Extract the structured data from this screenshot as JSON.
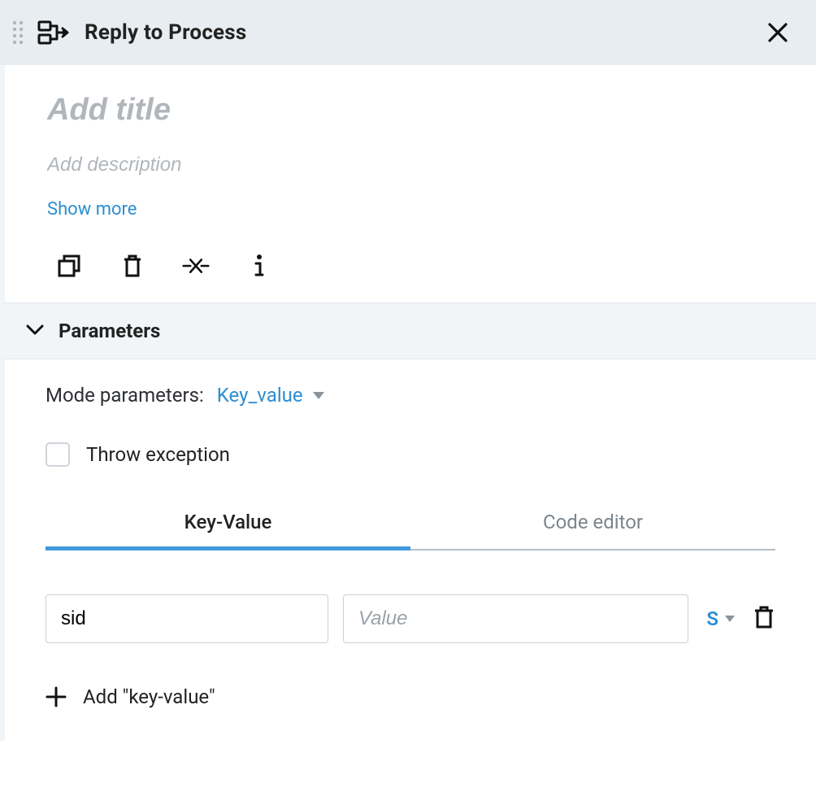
{
  "header": {
    "title": "Reply to Process"
  },
  "body": {
    "title_placeholder": "Add title",
    "title_value": "",
    "desc_placeholder": "Add description",
    "desc_value": "",
    "show_more": "Show more"
  },
  "section": {
    "parameters_label": "Parameters"
  },
  "params": {
    "mode_label": "Mode parameters:",
    "mode_value": "Key_value",
    "throw_label": "Throw exception",
    "throw_checked": false,
    "tabs": {
      "keyvalue": "Key-Value",
      "code": "Code editor"
    },
    "row": {
      "key": "sid",
      "value": "",
      "value_placeholder": "Value",
      "type": "S"
    },
    "add_label": "Add \"key-value\""
  }
}
